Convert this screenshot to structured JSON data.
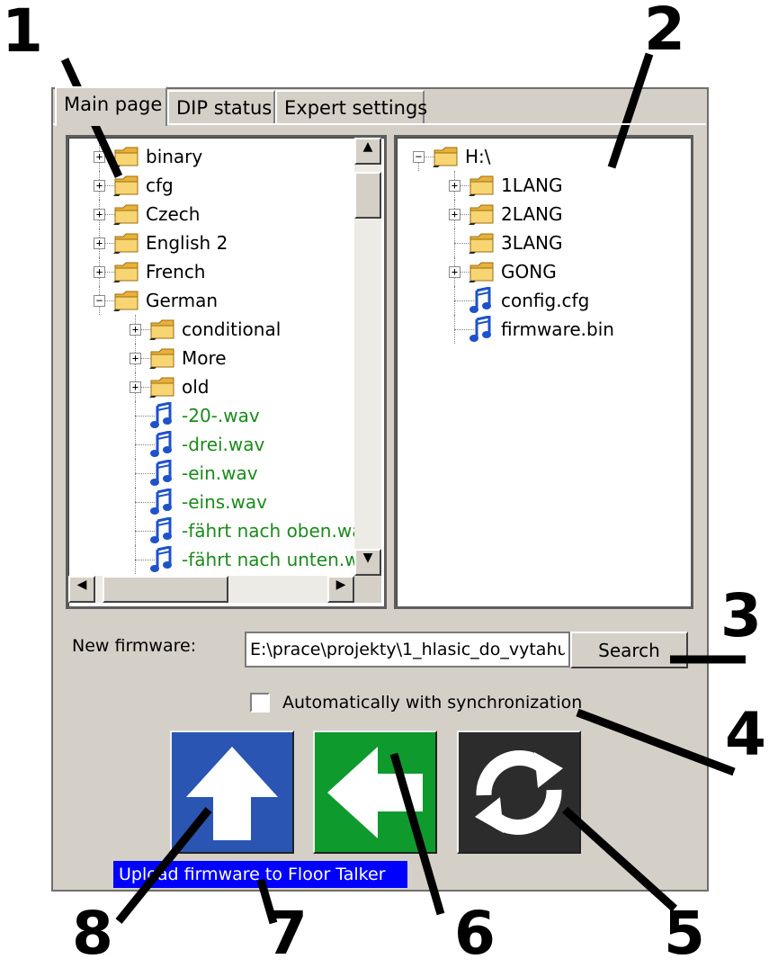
{
  "tabs": [
    {
      "label": "Main page",
      "active": true
    },
    {
      "label": "DIP status",
      "active": false
    },
    {
      "label": "Expert settings",
      "active": false
    }
  ],
  "local_tree": [
    {
      "label": "binary",
      "type": "folder",
      "expander": "+"
    },
    {
      "label": "cfg",
      "type": "folder",
      "expander": "+"
    },
    {
      "label": "Czech",
      "type": "folder",
      "expander": "+"
    },
    {
      "label": "English 2",
      "type": "folder",
      "expander": "+"
    },
    {
      "label": "French",
      "type": "folder",
      "expander": "+"
    },
    {
      "label": "German",
      "type": "folder",
      "expander": "−"
    },
    {
      "label": "conditional",
      "type": "folder",
      "expander": "+"
    },
    {
      "label": "More",
      "type": "folder",
      "expander": "+"
    },
    {
      "label": "old",
      "type": "folder",
      "expander": "+"
    },
    {
      "label": "-20-.wav",
      "type": "audio"
    },
    {
      "label": "-drei.wav",
      "type": "audio"
    },
    {
      "label": "-ein.wav",
      "type": "audio"
    },
    {
      "label": "-eins.wav",
      "type": "audio"
    },
    {
      "label": "-fährt nach oben.wav",
      "type": "audio"
    },
    {
      "label": "-fährt nach unten.wav",
      "type": "audio"
    }
  ],
  "device_tree": [
    {
      "label": "H:\\",
      "type": "folder",
      "expander": "−"
    },
    {
      "label": "1LANG",
      "type": "folder",
      "expander": "+"
    },
    {
      "label": "2LANG",
      "type": "folder",
      "expander": "+"
    },
    {
      "label": "3LANG",
      "type": "folder"
    },
    {
      "label": "GONG",
      "type": "folder",
      "expander": "+"
    },
    {
      "label": "config.cfg",
      "type": "audio"
    },
    {
      "label": "firmware.bin",
      "type": "audio"
    }
  ],
  "firmware": {
    "label": "New firmware:",
    "path": "E:\\prace\\projekty\\1_hlasic_do_vytahu",
    "search_label": "Search"
  },
  "sync": {
    "label": "Automatically with synchronization",
    "checked": false
  },
  "tooltip": "Upload firmware to Floor Talker",
  "buttons": [
    {
      "icon": "arrow-up-icon",
      "color": "#2a55b3"
    },
    {
      "icon": "arrow-left-icon",
      "color": "#0f9a2e"
    },
    {
      "icon": "sync-icon",
      "color": "#2c2c2c"
    }
  ],
  "callouts": [
    "1",
    "2",
    "3",
    "4",
    "5",
    "6",
    "7",
    "8"
  ],
  "colors": {
    "file_text": "#1b8a1b",
    "window_bg": "#d4d0c8",
    "tooltip_bg": "#0000ff"
  }
}
